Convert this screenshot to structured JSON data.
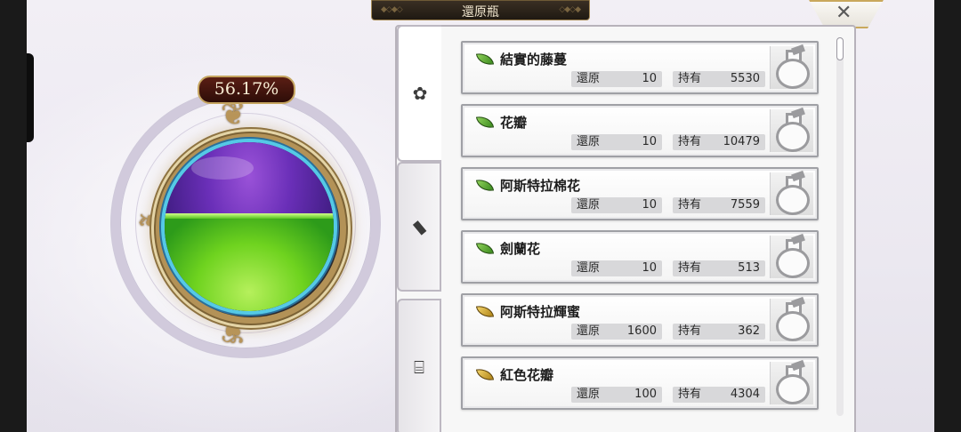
{
  "header": {
    "title": "還原瓶"
  },
  "gauge": {
    "percent_label": "56.17%",
    "fill_fraction": 0.5617
  },
  "tabs": [
    {
      "icon": "flower-icon",
      "active": true
    },
    {
      "icon": "stone-icon",
      "active": false
    },
    {
      "icon": "furniture-icon",
      "active": false
    }
  ],
  "labels": {
    "restore": "還原",
    "owned": "持有"
  },
  "items": [
    {
      "name": "結實的藤蔓",
      "restore": "10",
      "owned": "5530",
      "leaf": "green"
    },
    {
      "name": "花瓣",
      "restore": "10",
      "owned": "10479",
      "leaf": "green"
    },
    {
      "name": "阿斯特拉棉花",
      "restore": "10",
      "owned": "7559",
      "leaf": "green"
    },
    {
      "name": "劍蘭花",
      "restore": "10",
      "owned": "513",
      "leaf": "green"
    },
    {
      "name": "阿斯特拉輝蜜",
      "restore": "1600",
      "owned": "362",
      "leaf": "gold"
    },
    {
      "name": "紅色花瓣",
      "restore": "100",
      "owned": "4304",
      "leaf": "gold"
    }
  ],
  "colors": {
    "leaf_green": "#5aa82c",
    "leaf_gold": "#d4a92d",
    "gauge_fill": "#6fd31f",
    "gauge_empty": "#6a2fb8"
  }
}
